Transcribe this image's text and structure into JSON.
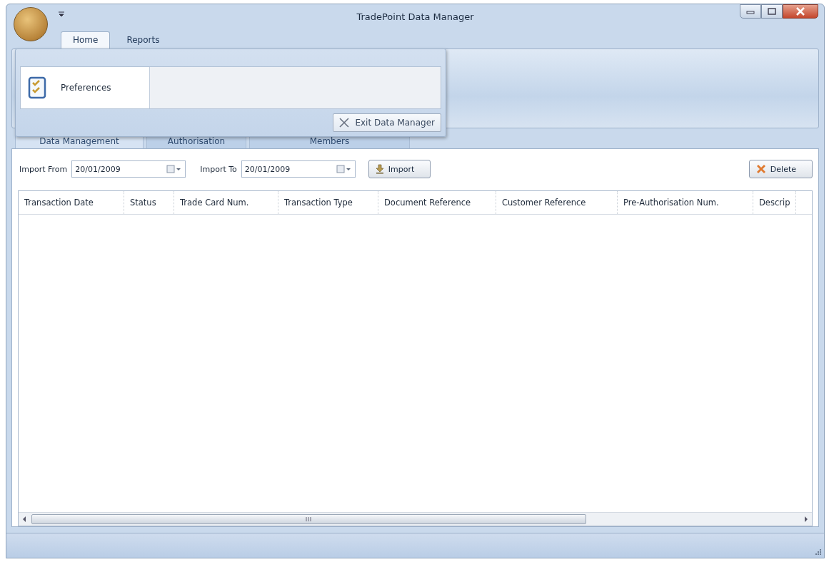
{
  "window": {
    "title": "TradePoint Data Manager"
  },
  "ribbon_tabs": [
    {
      "label": "Home",
      "selected": true
    },
    {
      "label": "Reports",
      "selected": false
    }
  ],
  "app_menu": {
    "items": [
      {
        "label": "Preferences"
      }
    ],
    "exit_button": "Exit Data Manager"
  },
  "page_tabs": [
    {
      "label": "Data Management",
      "selected": true
    },
    {
      "label": "Authorisation",
      "selected": false
    },
    {
      "label": "Members",
      "selected": false
    }
  ],
  "toolbar": {
    "import_from": {
      "label": "Import From",
      "value": "20/01/2009"
    },
    "import_to": {
      "label": "Import To",
      "value": "20/01/2009"
    },
    "import_button": "Import",
    "delete_button": "Delete"
  },
  "table": {
    "columns": [
      "Transaction Date",
      "Status",
      "Trade Card Num.",
      "Transaction Type",
      "Document Reference",
      "Customer Reference",
      "Pre-Authorisation Num.",
      "Descrip"
    ]
  }
}
